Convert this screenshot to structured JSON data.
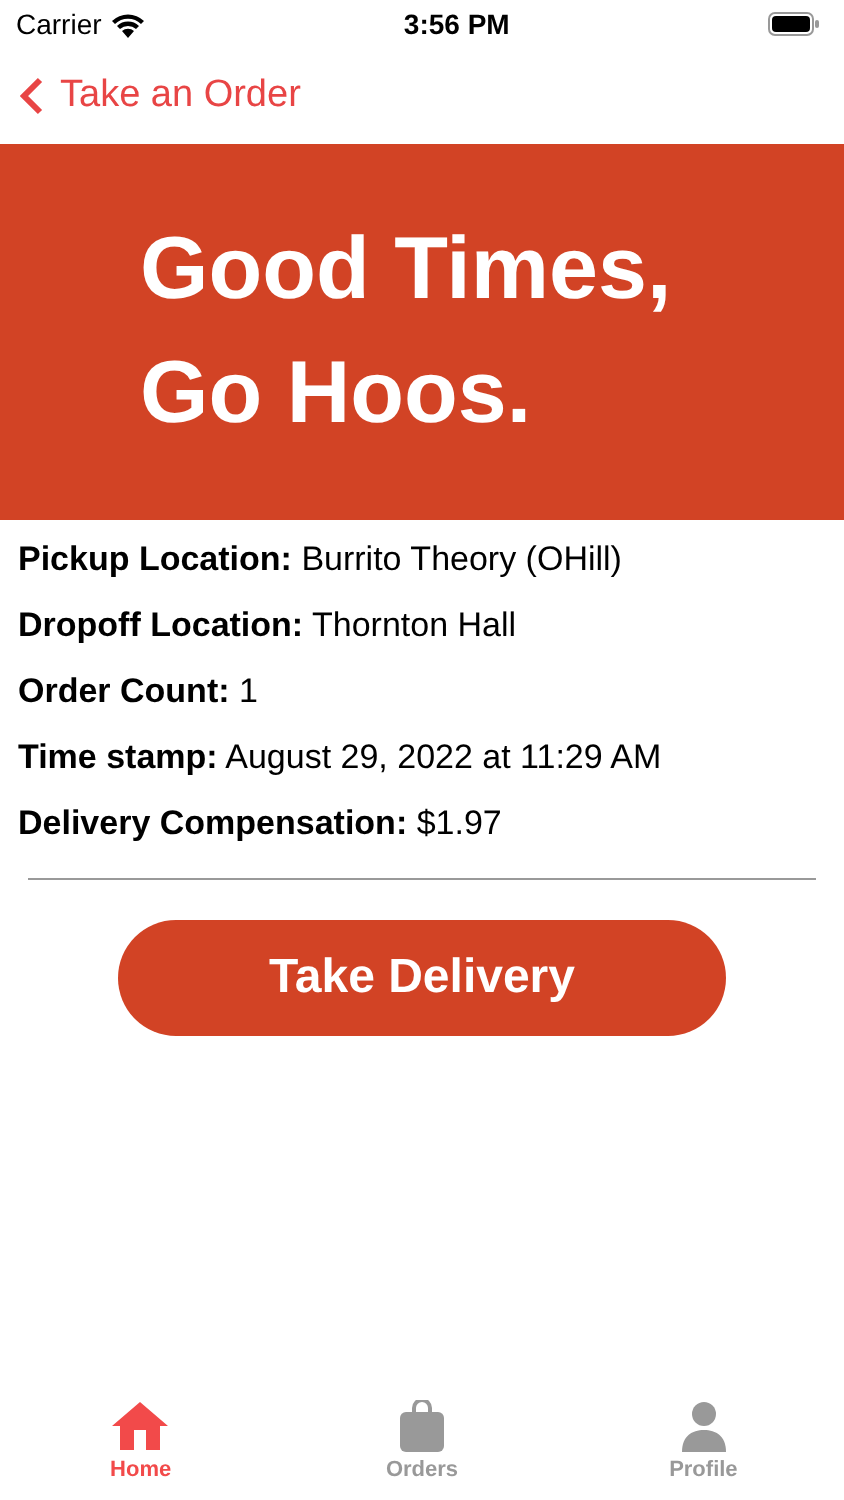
{
  "status_bar": {
    "carrier": "Carrier",
    "time": "3:56 PM"
  },
  "nav": {
    "back_label": "Take an Order"
  },
  "banner": {
    "lines": [
      "Good Times,",
      "Go Hoos."
    ]
  },
  "details": [
    "**Pickup Location:** Burrito Theory (OHill)",
    "**Dropoff Location:** Thornton Hall",
    "**Order Count:** 1",
    "**Time stamp:** August 29, 2022 at 11:29 AM",
    "**Delivery Compensation:** $1.97"
  ],
  "action_button": "Take Delivery",
  "tabs": [
    {
      "kind": "home",
      "label": "Home",
      "selected": true
    },
    {
      "kind": "bag",
      "label": "Orders",
      "selected": false
    },
    {
      "kind": "person",
      "label": "Profile",
      "selected": false
    }
  ]
}
